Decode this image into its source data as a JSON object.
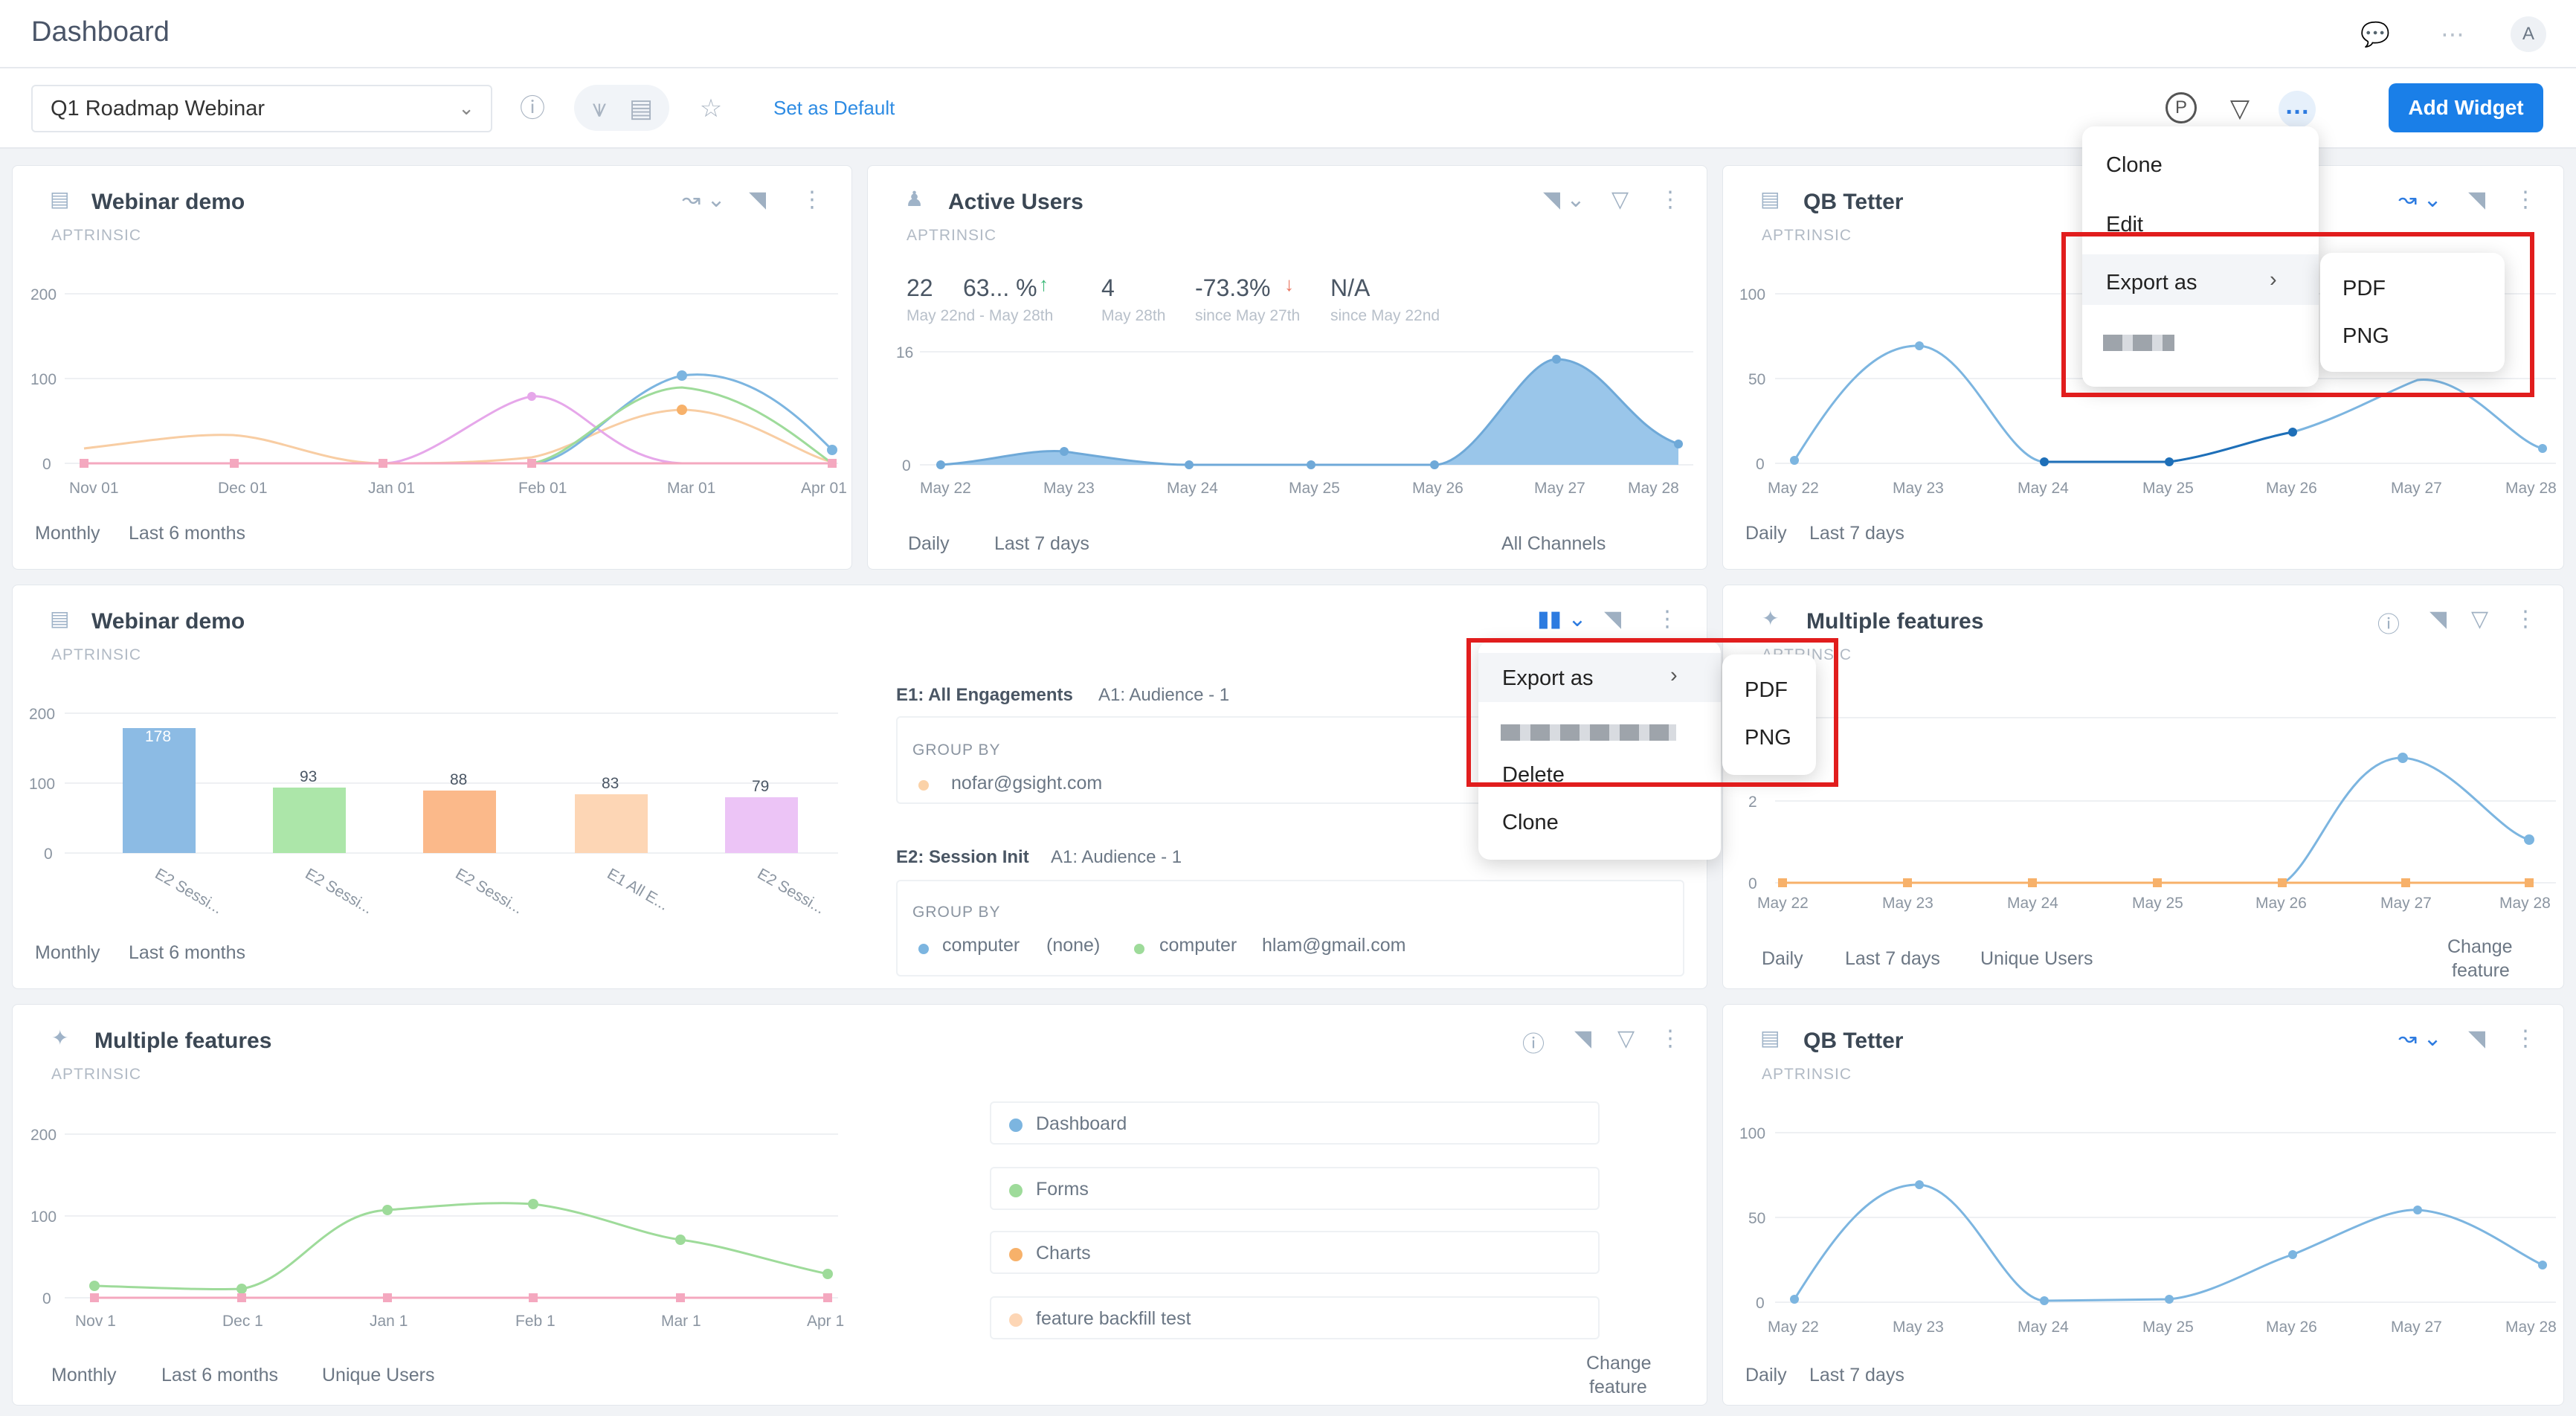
{
  "header": {
    "title": "Dashboard",
    "avatar": "A"
  },
  "toolbar": {
    "dashboard_name": "Q1 Roadmap Webinar",
    "set_default": "Set as Default",
    "add_widget": "Add Widget",
    "p_label": "P"
  },
  "cards": {
    "w1": {
      "title": "Webinar demo",
      "sub": "APTRINSIC",
      "period": "Monthly",
      "range": "Last 6 months",
      "y": [
        "200",
        "100",
        "0"
      ],
      "x": [
        "Nov 01",
        "Dec 01",
        "Jan 01",
        "Feb 01",
        "Mar 01",
        "Apr 01"
      ]
    },
    "w2": {
      "title": "Active Users",
      "sub": "APTRINSIC",
      "stats": [
        {
          "v": "22",
          "s": "May 22nd - May 28th"
        },
        {
          "v": "63... %",
          "s": ""
        },
        {
          "v": "4",
          "s": "May 28th"
        },
        {
          "v": "-73.3%",
          "s": "since May 27th"
        },
        {
          "v": "N/A",
          "s": "since May 22nd"
        }
      ],
      "y": [
        "16",
        "0"
      ],
      "x": [
        "May 22",
        "May 23",
        "May 24",
        "May 25",
        "May 26",
        "May 27",
        "May 28"
      ],
      "period": "Daily",
      "range": "Last 7 days",
      "channels": "All Channels"
    },
    "w3": {
      "title": "QB Tetter",
      "sub": "APTRINSIC",
      "y": [
        "100",
        "50",
        "0"
      ],
      "x": [
        "May 22",
        "May 23",
        "May 24",
        "May 25",
        "May 26",
        "May 27",
        "May 28"
      ],
      "period": "Daily",
      "range": "Last 7 days"
    },
    "w4": {
      "title": "Webinar demo",
      "sub": "APTRINSIC",
      "y": [
        "200",
        "100",
        "0"
      ],
      "bars": [
        "178",
        "93",
        "88",
        "83",
        "79"
      ],
      "xcats": [
        "E2 Sessi...",
        "E2 Sessi...",
        "E2 Sessi...",
        "E1 All E...",
        "E2 Sessi..."
      ],
      "period": "Monthly",
      "range": "Last 6 months",
      "e1": "E1: All Engagements",
      "a1": "A1: Audience - 1",
      "group_by": "GROUP BY",
      "g1": "nofar@gsight.com",
      "e2": "E2: Session Init",
      "a1b": "A1: Audience - 1",
      "group_by2": "GROUP BY",
      "g2a": "computer",
      "g2b": "(none)",
      "g2c": "computer",
      "g2d": "hlam@gmail.com"
    },
    "w5": {
      "title": "Multiple features",
      "sub": "APTRINSIC",
      "y": [
        "2",
        "0"
      ],
      "x": [
        "May 22",
        "May 23",
        "May 24",
        "May 25",
        "May 26",
        "May 27",
        "May 28"
      ],
      "period": "Daily",
      "range": "Last 7 days",
      "metric": "Unique Users",
      "change": "Change",
      "feature": "feature"
    },
    "w6": {
      "title": "Multiple features",
      "sub": "APTRINSIC",
      "y": [
        "200",
        "100",
        "0"
      ],
      "x": [
        "Nov 1",
        "Dec 1",
        "Jan 1",
        "Feb 1",
        "Mar 1",
        "Apr 1"
      ],
      "legend": [
        "Dashboard",
        "Forms",
        "Charts",
        "feature backfill test"
      ],
      "period": "Monthly",
      "range": "Last 6 months",
      "metric": "Unique Users",
      "change": "Change",
      "feature": "feature"
    },
    "w7": {
      "title": "QB Tetter",
      "sub": "APTRINSIC",
      "y": [
        "100",
        "50",
        "0"
      ],
      "x": [
        "May 22",
        "May 23",
        "May 24",
        "May 25",
        "May 26",
        "May 27",
        "May 28"
      ],
      "period": "Daily",
      "range": "Last 7 days"
    }
  },
  "menu_top": {
    "clone": "Clone",
    "edit": "Edit",
    "export": "Export as",
    "pdf": "PDF",
    "png": "PNG"
  },
  "menu_mid": {
    "export": "Export as",
    "delete": "Delete",
    "clone": "Clone",
    "pdf": "PDF",
    "png": "PNG"
  },
  "colors": {
    "accent": "#1a7fe8",
    "highlight": "#e11d1d",
    "blue_series": "#7cb5e0"
  }
}
